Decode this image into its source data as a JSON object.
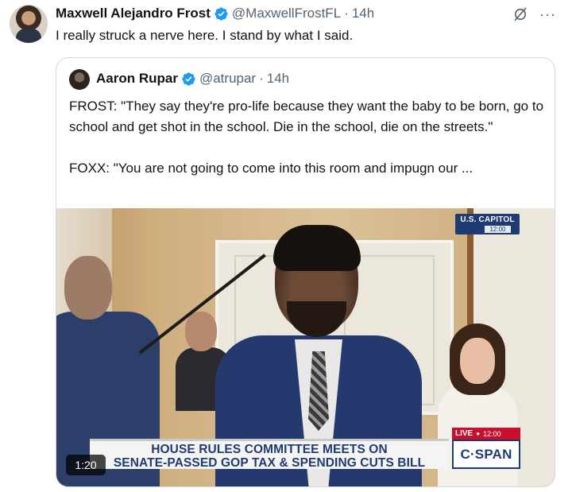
{
  "author": {
    "name": "Maxwell Alejandro Frost",
    "handle": "@MaxwellFrostFL",
    "separator": "·",
    "time": "14h",
    "text": "I really struck a nerve here. I stand by what I said."
  },
  "quoted": {
    "name": "Aaron Rupar",
    "handle": "@atrupar",
    "separator": "·",
    "time": "14h",
    "line1": "FROST: \"They say they're pro-life because they want the baby to be born, go to school and get shot in the school. Die in the school, die on the streets.\"",
    "line2": "FOXX: \"You are not going to come into this room and impugn our ..."
  },
  "video": {
    "capitol_bug": "U.S. CAPITOL",
    "capitol_time": "12:00",
    "chyron_line1": "HOUSE RULES COMMITTEE MEETS ON",
    "chyron_line2": "SENATE-PASSED GOP TAX & SPENDING CUTS BILL",
    "live_label": "LIVE",
    "live_dot": "●",
    "live_time": "12:00",
    "network": "C·SPAN",
    "duration": "1:20"
  },
  "colors": {
    "verified": "#1d9bf0",
    "cspan_blue": "#1f3b73",
    "live_red": "#c8102e"
  },
  "icons": {
    "more": "···"
  }
}
